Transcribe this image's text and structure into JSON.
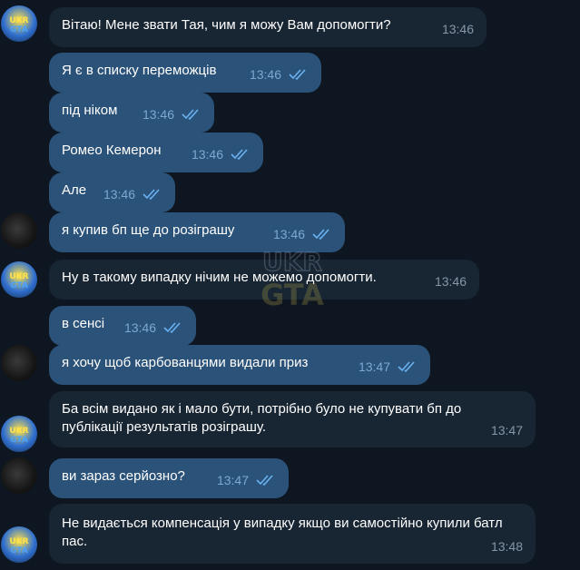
{
  "brand": {
    "accent": "#2b5278",
    "incoming_bg": "#182533",
    "app_bg": "#0e1621",
    "tick_color": "#6ab3f3"
  },
  "messages": [
    {
      "text": "Вітаю! Мене звати Тая, чим я можу Вам допомогти?",
      "time": "13:46",
      "dir": "in"
    },
    {
      "text": "Я є в списку переможців",
      "time": "13:46",
      "dir": "out"
    },
    {
      "text": "під ніком",
      "time": "13:46",
      "dir": "out"
    },
    {
      "text": "Ромео Кемерон",
      "time": "13:46",
      "dir": "out"
    },
    {
      "text": "Але",
      "time": "13:46",
      "dir": "out"
    },
    {
      "text": "я купив бп ще до розіграшу",
      "time": "13:46",
      "dir": "out"
    },
    {
      "text": "Ну в такому випадку нічим не можемо допомогти.",
      "time": "13:46",
      "dir": "in"
    },
    {
      "text": "в сенсі",
      "time": "13:46",
      "dir": "out"
    },
    {
      "text": "я хочу щоб карбованцями видали приз",
      "time": "13:47",
      "dir": "out"
    },
    {
      "text": "Ба всім видано як і мало бути, потрібно було не купувати бп до публікації результатів розіграшу.",
      "time": "13:47",
      "dir": "in"
    },
    {
      "text": "ви зараз серйозно?",
      "time": "13:47",
      "dir": "out"
    },
    {
      "text": "Не видається компенсація у випадку якщо ви самостійно купили батл пас.",
      "time": "13:48",
      "dir": "in"
    }
  ],
  "avatars": {
    "brand_icon": "ukraine-gta-logo",
    "user_icon": "user-car-photo"
  },
  "watermark": {
    "icon": "ukraine-gta-watermark"
  }
}
